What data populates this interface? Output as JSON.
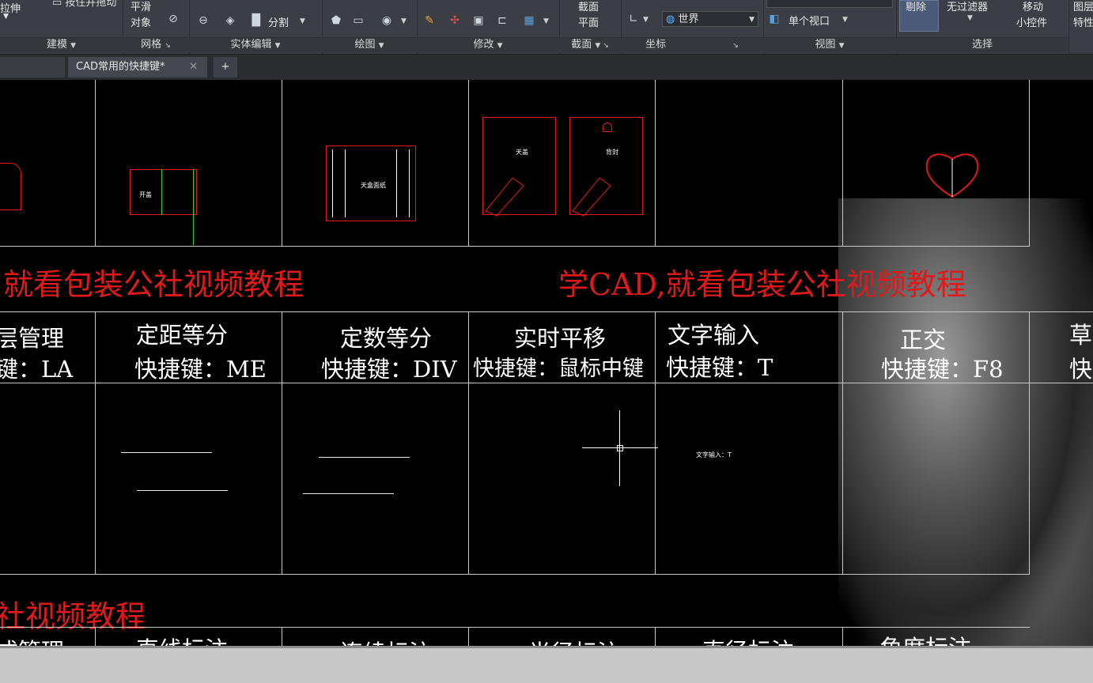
{
  "ribbon": {
    "panels": [
      {
        "title": "建模",
        "label": "建模"
      },
      {
        "title": "网格",
        "label": "网格"
      },
      {
        "title": "实体编辑",
        "label": "实体编辑"
      },
      {
        "title": "绘图",
        "label": "绘图"
      },
      {
        "title": "修改",
        "label": "修改"
      },
      {
        "title": "截面",
        "label": "截面"
      },
      {
        "title": "坐标",
        "label": "坐标"
      },
      {
        "title": "视图",
        "label": "视图"
      },
      {
        "title": "选择",
        "label": "选择"
      }
    ],
    "stretch_label": "拉伸",
    "smooth_label": "平滑",
    "object_label": "对象",
    "split_label": "分割",
    "section_plane_label": "截面\n平面",
    "section_line1": "截面",
    "section_line2": "平面",
    "world_dropdown": "世界",
    "viewport_dropdown": "单个视口",
    "remove_label": "剔除",
    "no_filter_label": "无过滤器",
    "move_label1": "移动",
    "move_label2": "小控件",
    "right_label1": "图层",
    "right_label2": "特性"
  },
  "tabs": {
    "active_tab": "CAD常用的快捷键*",
    "add_label": "+"
  },
  "drawing": {
    "banner_left": "就看包装公社视频教程",
    "banner_right": "学CAD,就看包装公社视频教程",
    "banner_bottom": "社视频教程",
    "row1": [
      {
        "name": "层管理",
        "key": "键：LA"
      },
      {
        "name": "定距等分",
        "key": "快捷键：ME"
      },
      {
        "name": "定数等分",
        "key": "快捷键：DIV"
      },
      {
        "name": "实时平移",
        "key": "快捷键：鼠标中键"
      },
      {
        "name": "文字输入",
        "key": "快捷键：T"
      },
      {
        "name": "正交",
        "key": "快捷键：F8"
      },
      {
        "name": "草",
        "key": "快"
      }
    ],
    "row2_partial": [
      "式管理",
      "直线标注",
      "连续标注",
      "半径标注",
      "直径标注",
      "角度标注"
    ],
    "small_labels": {
      "box1": "开盖",
      "box2": "天盒面纸",
      "box3": "天盖",
      "box4": "背封",
      "text_input_sample": "文字输入：T"
    }
  }
}
